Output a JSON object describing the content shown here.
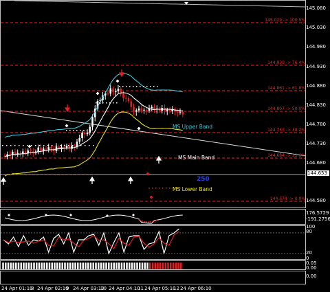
{
  "main_chart": {
    "price_ticks": [
      "145.080",
      "145.030",
      "144.980",
      "144.930",
      "144.880",
      "144.830",
      "144.780",
      "144.730",
      "144.680",
      "144.580"
    ],
    "current_price": "144.653",
    "price_marker_text": "250",
    "fib_levels": [
      "145.029 -> 100.0%",
      "144.939 -> 76.4%",
      "144.861 -> 61.8%",
      "144.807 -> 50.0%",
      "144.753 -> 38.2%",
      "144.684 -> 23.6%",
      "144.574 -> 0.0%"
    ],
    "band_labels": {
      "upper": "MS Upper Band",
      "main": "MS Main Band",
      "lower": "MS Lower Band"
    },
    "colors": {
      "background": "#000000",
      "fib": "#ff2020",
      "upper_band": "#3fc8d8",
      "main_band": "#ffffff",
      "lower_band": "#e8e020",
      "bull_candle": "#ffffff",
      "bear_candle": "#e02020",
      "marker_blue": "#2040ff"
    }
  },
  "indicator_1": {
    "ticks": [
      "176.5729",
      "-191.2756"
    ]
  },
  "indicator_2": {
    "ticks": [
      "100",
      "80",
      "20",
      "0"
    ]
  },
  "indicator_3": {
    "ticks": [
      "0.05",
      "0.00"
    ]
  },
  "indicator_4": {
    "ticks": [
      "0.00"
    ]
  },
  "time_axis": {
    "labels": [
      "24 Apr 01:10",
      "8",
      "24 Apr 02:10",
      "9",
      "24 Apr 03:10",
      "10",
      "24 Apr 04:10",
      "11",
      "24 Apr 05:10",
      "12",
      "24 Apr 06:10"
    ]
  }
}
